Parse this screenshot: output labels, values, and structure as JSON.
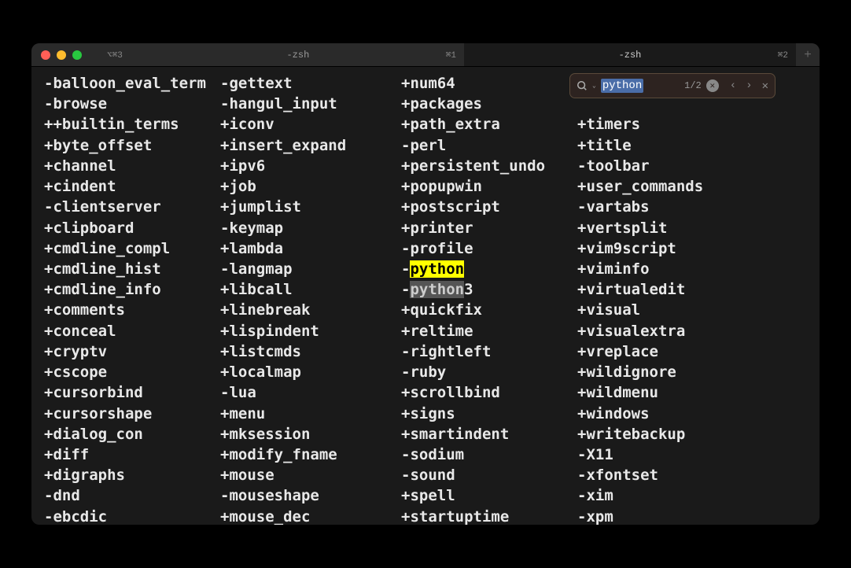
{
  "titlebar": {
    "tab_prefix": "⌥⌘3",
    "tabs": [
      {
        "label": "-zsh",
        "shortcut": "⌘1",
        "active": false
      },
      {
        "label": "-zsh",
        "shortcut": "⌘2",
        "active": true
      }
    ],
    "new_tab": "+"
  },
  "search": {
    "query": "python",
    "count": "1/2",
    "clear": "✕",
    "prev": "‹",
    "next": "›",
    "close": "✕"
  },
  "columns": {
    "col1": [
      "-balloon_eval_term",
      "-browse",
      "++builtin_terms",
      "+byte_offset",
      "+channel",
      "+cindent",
      "-clientserver",
      "+clipboard",
      "+cmdline_compl",
      "+cmdline_hist",
      "+cmdline_info",
      "+comments",
      "+conceal",
      "+cryptv",
      "+cscope",
      "+cursorbind",
      "+cursorshape",
      "+dialog_con",
      "+diff",
      "+digraphs",
      "-dnd",
      "-ebcdic"
    ],
    "col2": [
      "-gettext",
      "-hangul_input",
      "+iconv",
      "+insert_expand",
      "+ipv6",
      "+job",
      "+jumplist",
      "-keymap",
      "+lambda",
      "-langmap",
      "+libcall",
      "+linebreak",
      "+lispindent",
      "+listcmds",
      "+localmap",
      "-lua",
      "+menu",
      "+mksession",
      "+modify_fname",
      "+mouse",
      "-mouseshape",
      "+mouse_dec"
    ],
    "col3": [
      {
        "prefix": "+",
        "text": "num64"
      },
      {
        "prefix": "+",
        "text": "packages"
      },
      {
        "prefix": "+",
        "text": "path_extra"
      },
      {
        "prefix": "-",
        "text": "perl"
      },
      {
        "prefix": "+",
        "text": "persistent_undo"
      },
      {
        "prefix": "+",
        "text": "popupwin"
      },
      {
        "prefix": "+",
        "text": "postscript"
      },
      {
        "prefix": "+",
        "text": "printer"
      },
      {
        "prefix": "-",
        "text": "profile"
      },
      {
        "prefix": "-",
        "text": "python",
        "highlight": "active"
      },
      {
        "prefix": "-",
        "text": "python",
        "suffix": "3",
        "highlight": "inactive"
      },
      {
        "prefix": "+",
        "text": "quickfix"
      },
      {
        "prefix": "+",
        "text": "reltime"
      },
      {
        "prefix": "-",
        "text": "rightleft"
      },
      {
        "prefix": "-",
        "text": "ruby"
      },
      {
        "prefix": "+",
        "text": "scrollbind"
      },
      {
        "prefix": "+",
        "text": "signs"
      },
      {
        "prefix": "+",
        "text": "smartindent"
      },
      {
        "prefix": "-",
        "text": "sodium"
      },
      {
        "prefix": "-",
        "text": "sound"
      },
      {
        "prefix": "+",
        "text": "spell"
      },
      {
        "prefix": "+",
        "text": "startuptime"
      }
    ],
    "col4": [
      " ",
      " ",
      "+timers",
      "+title",
      "-toolbar",
      "+user_commands",
      "-vartabs",
      "+vertsplit",
      "+vim9script",
      "+viminfo",
      "+virtualedit",
      "+visual",
      "+visualextra",
      "+vreplace",
      "+wildignore",
      "+wildmenu",
      "+windows",
      "+writebackup",
      "-X11",
      "-xfontset",
      "-xim",
      "-xpm"
    ]
  }
}
